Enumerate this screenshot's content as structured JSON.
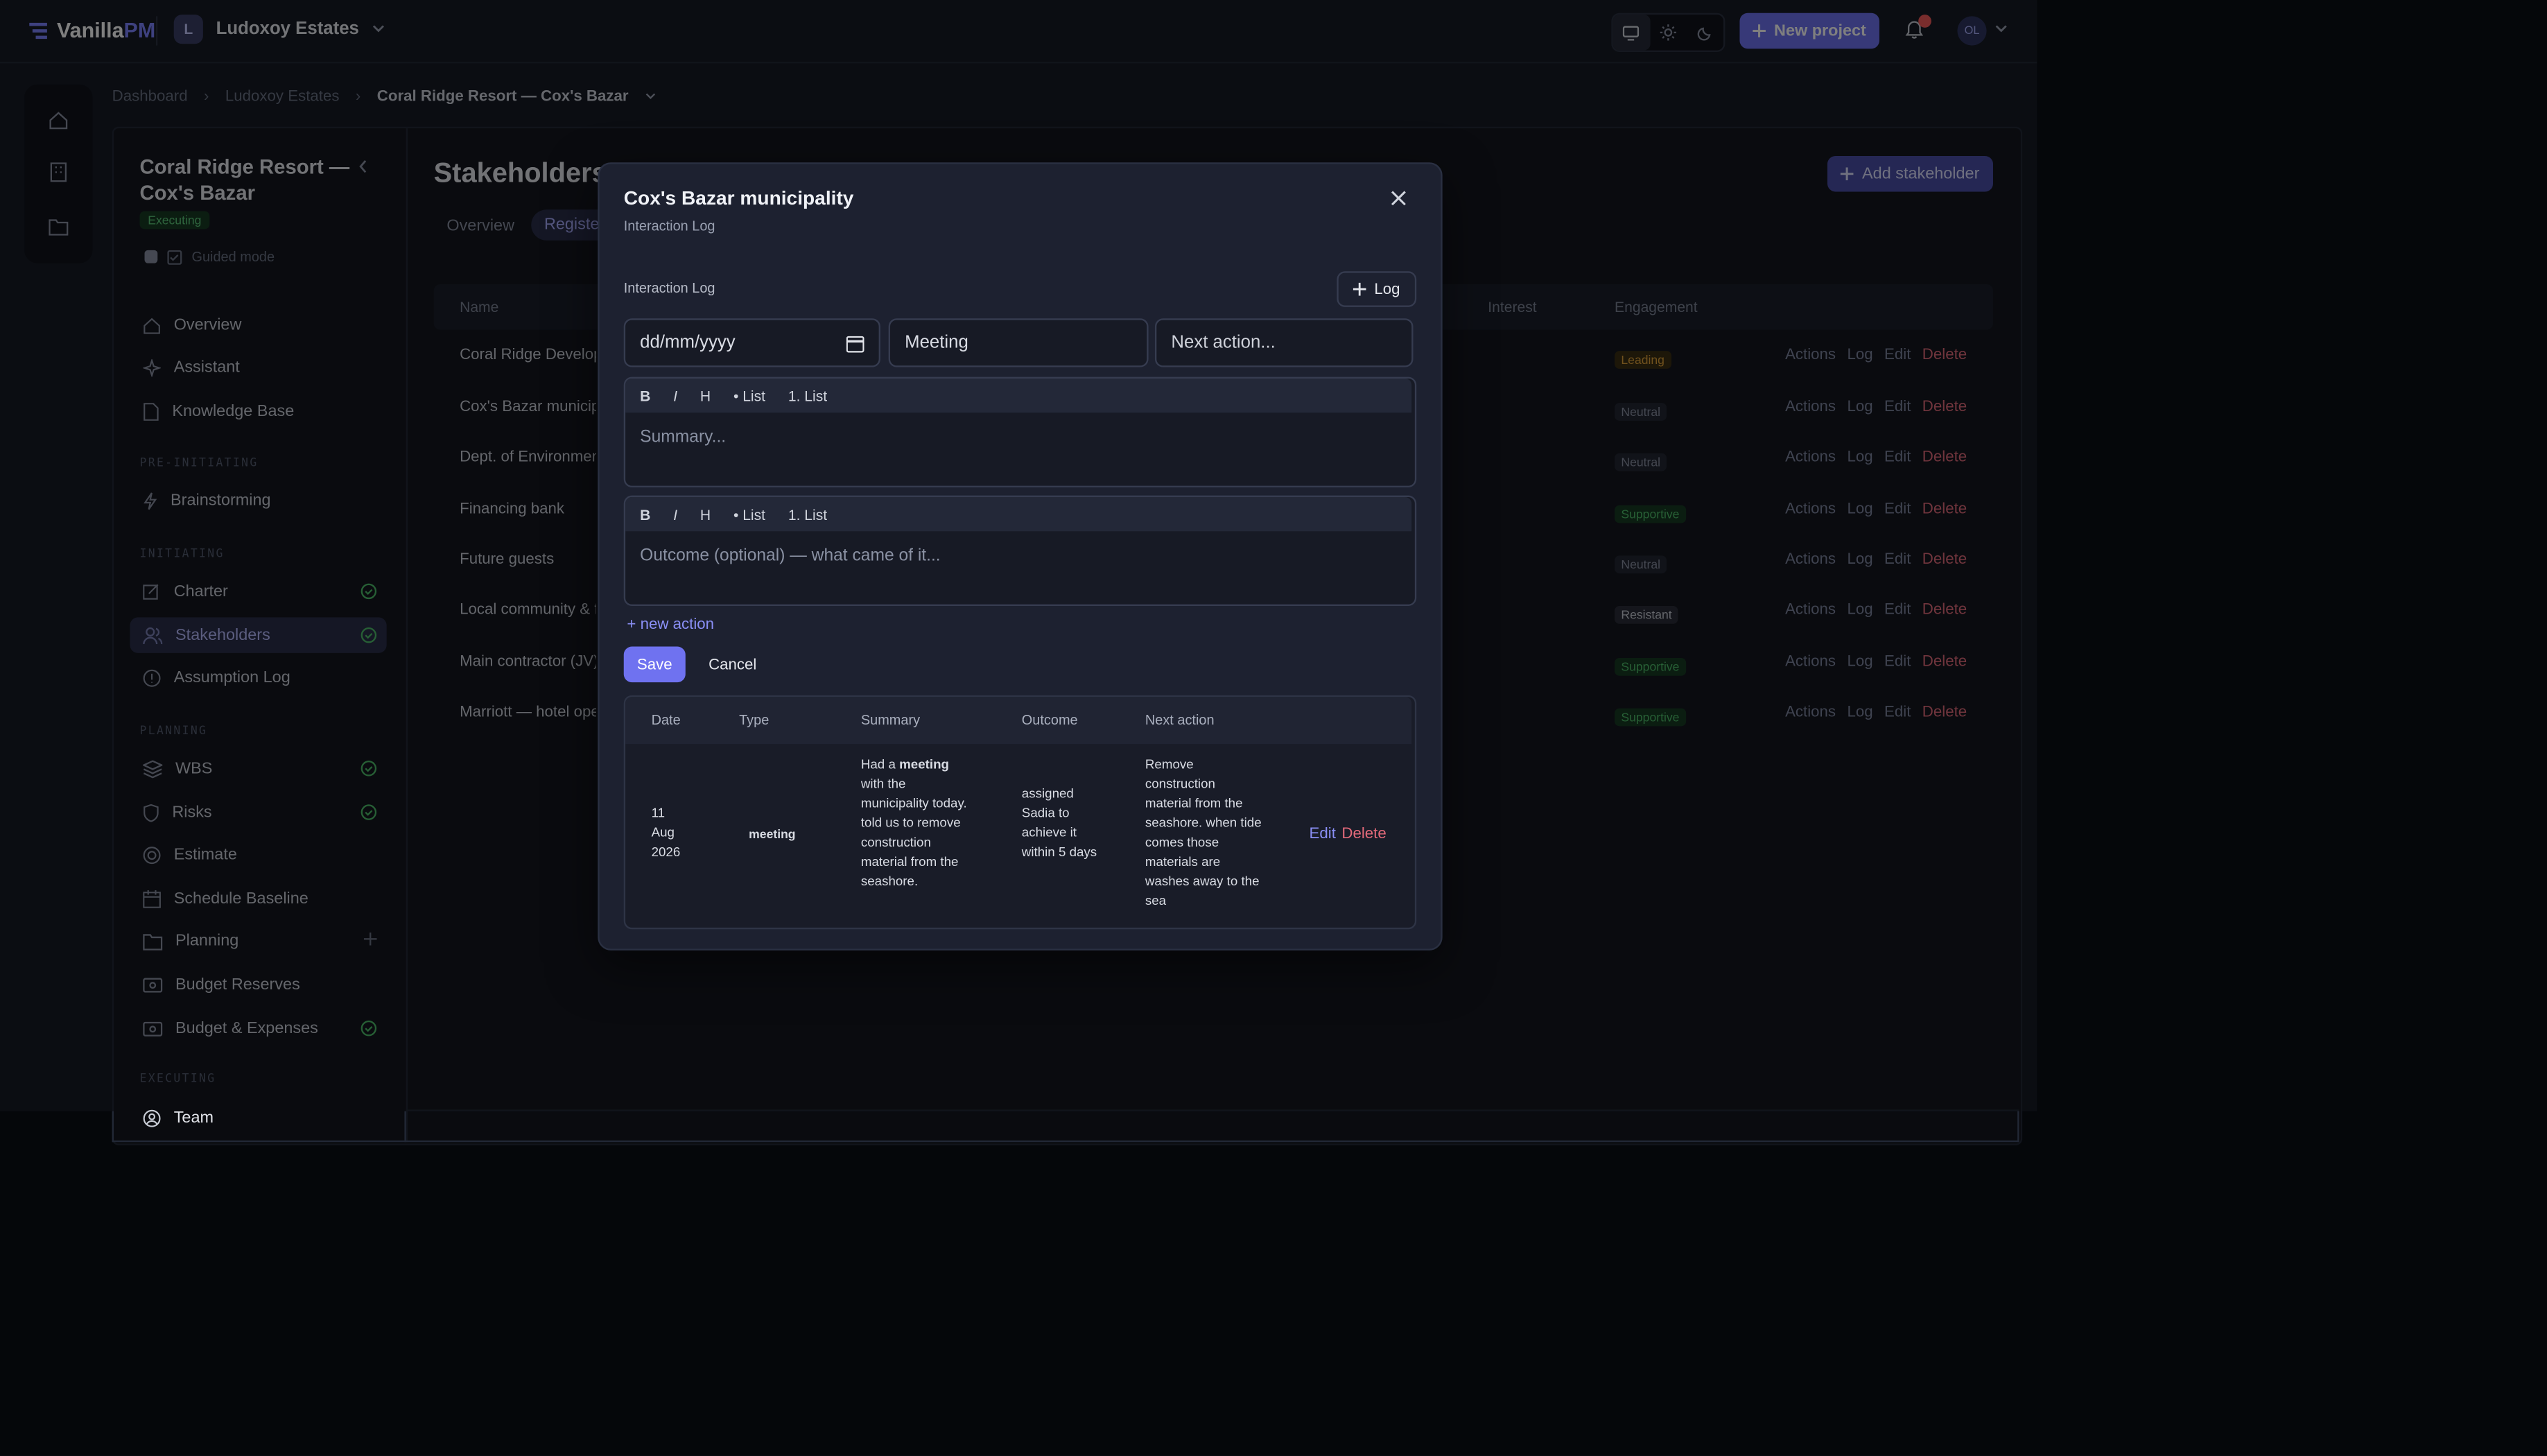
{
  "app": {
    "brand_main": "Vanilla",
    "brand_accent": "PM",
    "workspace_initial": "L",
    "workspace_name": "Ludoxoy Estates",
    "new_project": "New project",
    "notif_count": "1",
    "avatar": "OL"
  },
  "breadcrumb": [
    "Dashboard",
    "Ludoxoy Estates",
    "Coral Ridge Resort — Cox's Bazar"
  ],
  "project": {
    "title": "Coral Ridge Resort — Cox's Bazar",
    "status": "Executing",
    "guided_mode": "Guided mode"
  },
  "nav": {
    "overview": "Overview",
    "assistant": "Assistant",
    "knowledge": "Knowledge Base",
    "sec_pre": "PRE-INITIATING",
    "brainstorming": "Brainstorming",
    "sec_init": "INITIATING",
    "charter": "Charter",
    "stakeholders": "Stakeholders",
    "assumption": "Assumption Log",
    "sec_plan": "PLANNING",
    "wbs": "WBS",
    "risks": "Risks",
    "estimate": "Estimate",
    "schedule": "Schedule Baseline",
    "planning": "Planning",
    "reserves": "Budget Reserves",
    "expenses": "Budget & Expenses",
    "sec_exec": "EXECUTING",
    "team": "Team"
  },
  "main": {
    "title": "Stakeholders",
    "tab_overview": "Overview",
    "tab_register": "Register",
    "add_button": "Add stakeholder",
    "col_name": "Name",
    "col_interest": "Interest",
    "col_engagement": "Engagement",
    "action_actions": "Actions",
    "action_log": "Log",
    "action_edit": "Edit",
    "action_delete": "Delete",
    "rows": [
      {
        "name": "Coral Ridge Development",
        "engagement": "Leading"
      },
      {
        "name": "Cox's Bazar municipality",
        "engagement": "Neutral"
      },
      {
        "name": "Dept. of Environment",
        "engagement": "Neutral"
      },
      {
        "name": "Financing bank",
        "engagement": "Supportive"
      },
      {
        "name": "Future guests",
        "engagement": "Neutral"
      },
      {
        "name": "Local community & fishermen",
        "engagement": "Resistant"
      },
      {
        "name": "Main contractor (JV)",
        "engagement": "Supportive"
      },
      {
        "name": "Marriott — hotel operator",
        "engagement": "Supportive"
      }
    ]
  },
  "modal": {
    "title": "Cox's Bazar municipality",
    "subtitle": "Interaction Log",
    "section": "Interaction Log",
    "log_button": "Log",
    "date_placeholder": "dd/mm/yyyy",
    "type_value": "Meeting",
    "next_placeholder": "Next action...",
    "toolbar": {
      "bold": "B",
      "italic": "I",
      "heading": "H",
      "bullet": "• List",
      "numbered": "1. List"
    },
    "summary_placeholder": "Summary...",
    "outcome_placeholder": "Outcome (optional) — what came of it...",
    "new_action": "+ new action",
    "save": "Save",
    "cancel": "Cancel",
    "table_headers": {
      "date": "Date",
      "type": "Type",
      "summary": "Summary",
      "outcome": "Outcome",
      "next": "Next action"
    },
    "entry": {
      "date_day": "11",
      "date_month": "Aug",
      "date_year": "2026",
      "type": "meeting",
      "summary_pre": "Had a",
      "summary_bold": "meeting",
      "summary_post": "with the municipality today. told us to remove construction material from the seashore.",
      "outcome": "assigned Sadia to achieve it within 5 days",
      "next": "Remove construction material from the seashore. when tide comes those materials are washes away to the sea",
      "edit": "Edit",
      "delete": "Delete"
    }
  },
  "colors": {
    "accent": "#6f72f0",
    "supportive": "#4fbf6a",
    "neutral": "#8a91a3",
    "leading": "#e0a23a",
    "resistant": "#c9cdd6",
    "delete": "#e36a7a"
  }
}
